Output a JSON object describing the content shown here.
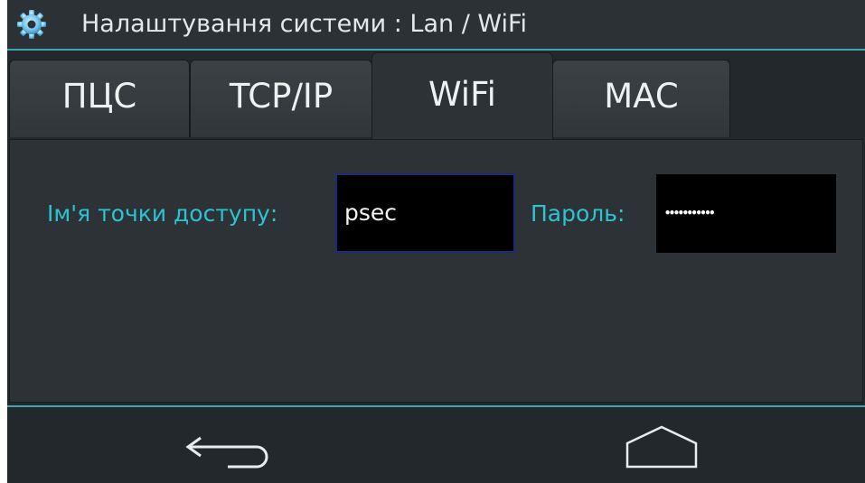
{
  "title_bar": {
    "icon": "gear-icon",
    "title": "Налаштування системи : Lan / WiFi"
  },
  "tabs": [
    {
      "label": "ПЦС",
      "active": false
    },
    {
      "label": "TCP/IP",
      "active": false
    },
    {
      "label": "WiFi",
      "active": true
    },
    {
      "label": "MAC",
      "active": false
    }
  ],
  "wifi": {
    "ssid_label": "Ім'я точки доступу:",
    "ssid_value": "psec",
    "password_label": "Пароль:",
    "password_mask": "•••••••••••"
  },
  "nav": {
    "back_icon": "back-arrow-icon",
    "home_icon": "home-icon"
  },
  "colors": {
    "accent": "#3fa7b3",
    "label_cyan": "#2dc3d3",
    "background": "#23282c",
    "panel": "#2c3236"
  }
}
